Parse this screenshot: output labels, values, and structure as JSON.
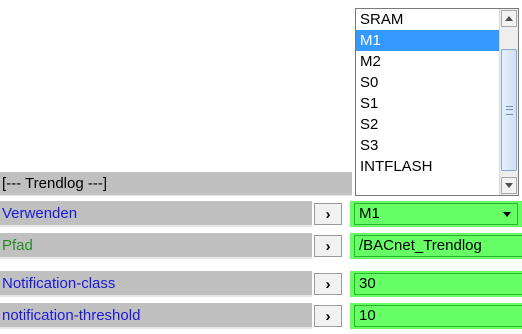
{
  "section": {
    "title": "[--- Trendlog ---]"
  },
  "rows": [
    {
      "label": "Verwenden",
      "value": "M1",
      "arrow_icon": "chevron-right-icon",
      "kind": "select"
    },
    {
      "label": "Pfad",
      "value": "/BACnet_Trendlog",
      "arrow_icon": "chevron-right-icon",
      "kind": "text"
    },
    {
      "label": "Notification-class",
      "value": "30",
      "arrow_icon": "chevron-right-icon",
      "kind": "text"
    },
    {
      "label": "notification-threshold",
      "value": "10",
      "arrow_icon": "chevron-right-icon",
      "kind": "text"
    }
  ],
  "arrow_glyph": "›",
  "dropdown": {
    "options": [
      "SRAM",
      "M1",
      "M2",
      "S0",
      "S1",
      "S2",
      "S3",
      "INTFLASH"
    ],
    "selected": "M1",
    "selected_index": 1
  },
  "colors": {
    "label_bg": "#c0c0c0",
    "value_bg": "#66ff66",
    "label_blue": "#1a1ad6",
    "label_green": "#2a8a2a",
    "selection": "#3399ff"
  }
}
